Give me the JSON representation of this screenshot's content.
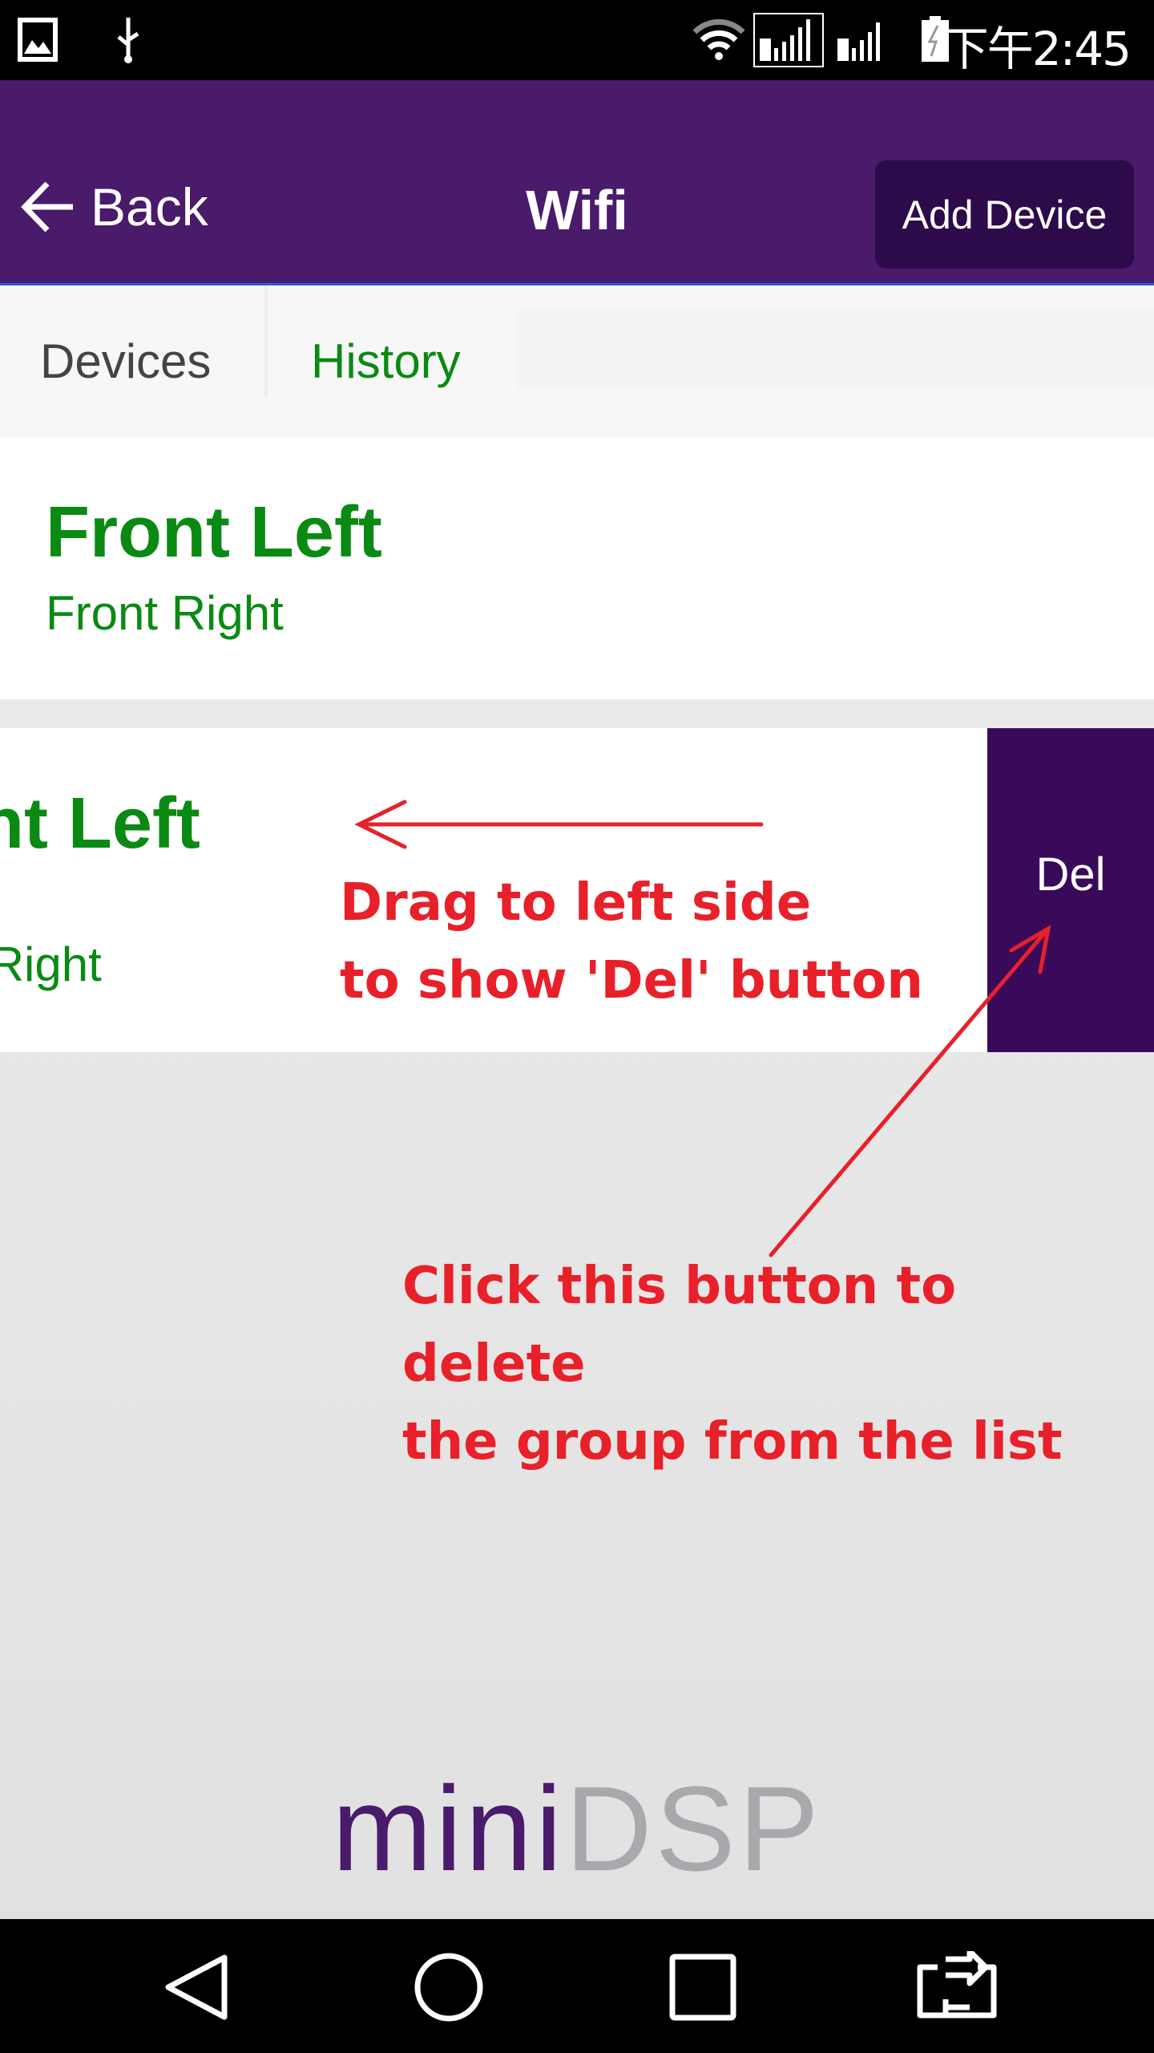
{
  "status_bar": {
    "time": "下午2:45",
    "icons": [
      "image-icon",
      "usb-icon",
      "wifi-icon",
      "sim1-signal-icon",
      "sim2-signal-icon",
      "battery-charging-icon"
    ]
  },
  "header": {
    "back_label": "Back",
    "title": "Wifi",
    "add_device_label": "Add Device"
  },
  "tabs": [
    {
      "label": "Devices"
    },
    {
      "label": "History"
    }
  ],
  "groups": [
    {
      "primary": "Front Left",
      "secondary": "Front Right"
    },
    {
      "primary": "Front Left",
      "secondary": "Front Right",
      "swiped": true,
      "action_label": "Del"
    }
  ],
  "annotations": {
    "drag_line1": "Drag to left side",
    "drag_line2": "to show 'Del' button",
    "click_line1": "Click this button to delete",
    "click_line2": "the group from the list"
  },
  "logo": {
    "text": "miniDSP"
  },
  "colors": {
    "header": "#4a1a6b",
    "button": "#2d0a4a",
    "del": "#3a0a5a",
    "green": "#0a8a12",
    "annotation": "#e8202a"
  },
  "nav": [
    "back-icon",
    "home-icon",
    "recents-icon",
    "switch-icon"
  ]
}
